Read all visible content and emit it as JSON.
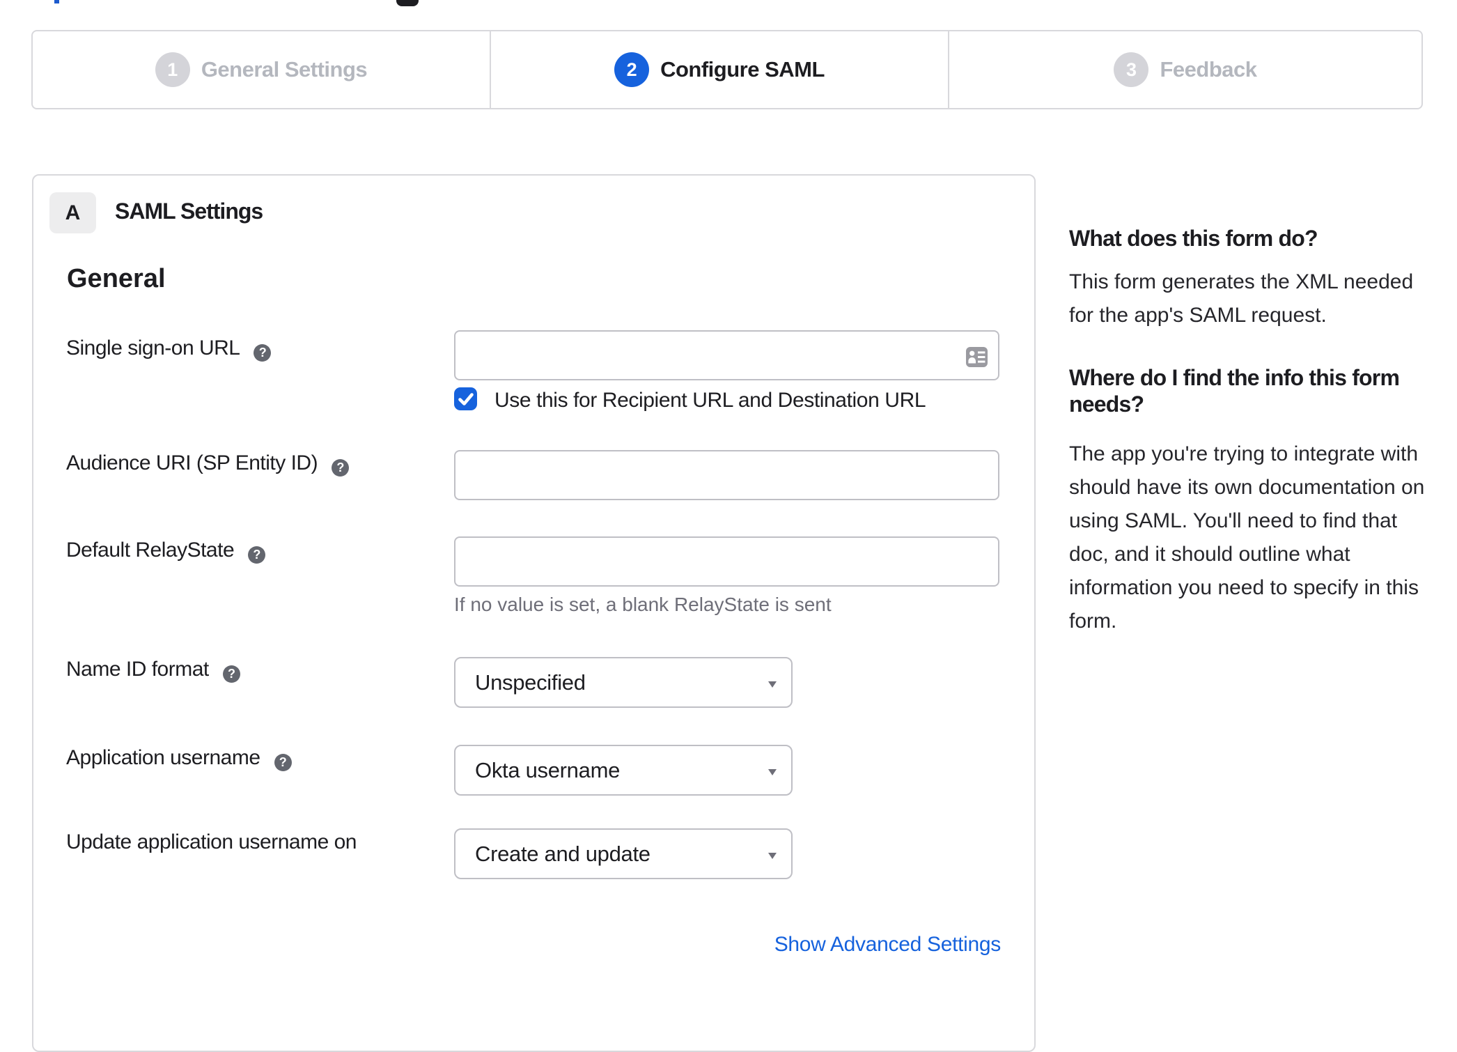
{
  "stepper": {
    "steps": [
      {
        "number": "1",
        "label": "General Settings",
        "state": "inactive"
      },
      {
        "number": "2",
        "label": "Configure SAML",
        "state": "active"
      },
      {
        "number": "3",
        "label": "Feedback",
        "state": "inactive"
      }
    ]
  },
  "panel": {
    "section_badge": "A",
    "section_title": "SAML Settings",
    "group_title": "General",
    "fields": {
      "sso_url": {
        "label": "Single sign-on URL",
        "value": "",
        "checkbox_label": "Use this for Recipient URL and Destination URL",
        "checkbox_checked": true
      },
      "audience_uri": {
        "label": "Audience URI (SP Entity ID)",
        "value": ""
      },
      "default_relaystate": {
        "label": "Default RelayState",
        "value": "",
        "hint": "If no value is set, a blank RelayState is sent"
      },
      "name_id_format": {
        "label": "Name ID format",
        "value": "Unspecified"
      },
      "application_username": {
        "label": "Application username",
        "value": "Okta username"
      },
      "update_app_username": {
        "label": "Update application username on",
        "value": "Create and update"
      }
    },
    "show_advanced_label": "Show Advanced Settings"
  },
  "sidebar": {
    "help1_title": "What does this form do?",
    "help1_lines": [
      "This form generates the XML needed",
      "for the app's SAML request."
    ],
    "help2_title_lines": [
      "Where do I find the info this form",
      "needs?"
    ],
    "help2_lines": [
      "The app you're trying to integrate with",
      "should have its own documentation on",
      "using SAML. You'll need to find that",
      "doc, and it should outline what",
      "information you need to specify in this",
      "form."
    ]
  },
  "colors": {
    "accent_blue": "#1662dd",
    "border_gray": "#d8d8dc",
    "input_border": "#bfbfc5",
    "muted_text": "#6e6e78"
  }
}
